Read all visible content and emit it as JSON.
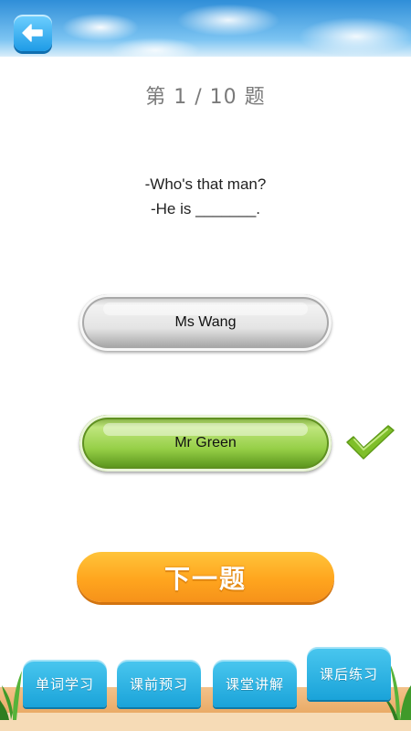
{
  "header": {
    "back_icon": "back-arrow-icon"
  },
  "quiz": {
    "progress": "第 1 / 10  题",
    "question_line1": "-Who's that man?",
    "question_line2": "-He is _______.",
    "options": [
      {
        "label": "Ms Wang",
        "state": "unselected"
      },
      {
        "label": "Mr Green",
        "state": "correct"
      }
    ],
    "correct_icon": "checkmark-icon",
    "next_label": "下一题"
  },
  "bottom_tabs": [
    {
      "label": "单词学习"
    },
    {
      "label": "课前预习"
    },
    {
      "label": "课堂讲解"
    },
    {
      "label": "课后练习",
      "active": true
    }
  ],
  "colors": {
    "accent": "#ffa51e",
    "correct": "#7fbf2a",
    "tab": "#2bb3e3"
  }
}
